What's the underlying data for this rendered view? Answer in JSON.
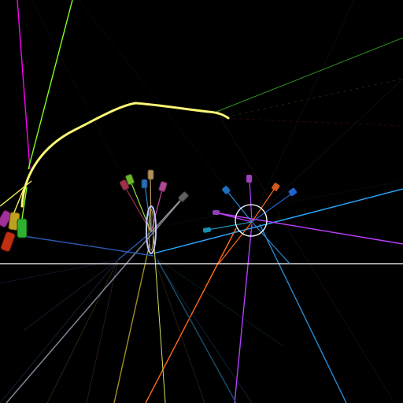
{
  "scene": {
    "background": "#000000",
    "horizon_color": "#ffffff",
    "trail_color": "#f4f060",
    "target_ring_color": "#ffffff"
  },
  "emitter_left": {
    "name": "left-emitter-fan",
    "pod_colors": [
      "#a0304a",
      "#6fb52a",
      "#2a6fb5",
      "#b0905a",
      "#b04a90",
      "#606060"
    ],
    "lens_color": "#bfc6ff"
  },
  "emitter_right": {
    "name": "right-emitter-fan",
    "pod_colors": [
      "#1a6fc0",
      "#a040c0",
      "#d05a20",
      "#2060d0",
      "#9040b0",
      "#1a8fb0"
    ]
  },
  "cluster_left": {
    "pod_colors": [
      "#a0309a",
      "#c0a020",
      "#30b030",
      "#c03010"
    ]
  },
  "beam_colors": [
    "#ff00ff",
    "#7fff20",
    "#1e90ff",
    "#ff6a1a",
    "#b040ff",
    "#2aa9ff",
    "#f4f060",
    "#30c030"
  ]
}
